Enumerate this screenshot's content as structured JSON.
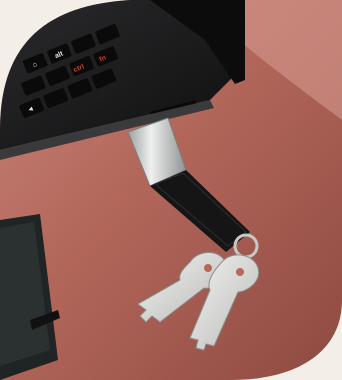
{
  "image": {
    "subject": "laptop-with-usb-keychain-and-keys",
    "palette": {
      "background": "#f3efe8",
      "desk": "#b66b5c",
      "desk_highlight": "#d4948a",
      "laptop": "#1b1b1c",
      "key_red": "#c8402f",
      "leather": "#161616",
      "metal": "#c7c9c9",
      "key_silver": "#dfe0de",
      "notebook": "#1f2424"
    }
  },
  "keyboard": {
    "visible_keys": [
      {
        "glyph": "⌂",
        "color": "#e7e7e7"
      },
      {
        "glyph": "alt",
        "color": "#e7e7e7"
      },
      {
        "glyph": "ctrl",
        "color": "#c8402f"
      },
      {
        "glyph": "fn",
        "color": "#c8402f"
      },
      {
        "glyph": "◄",
        "color": "#e7e7e7"
      }
    ]
  }
}
